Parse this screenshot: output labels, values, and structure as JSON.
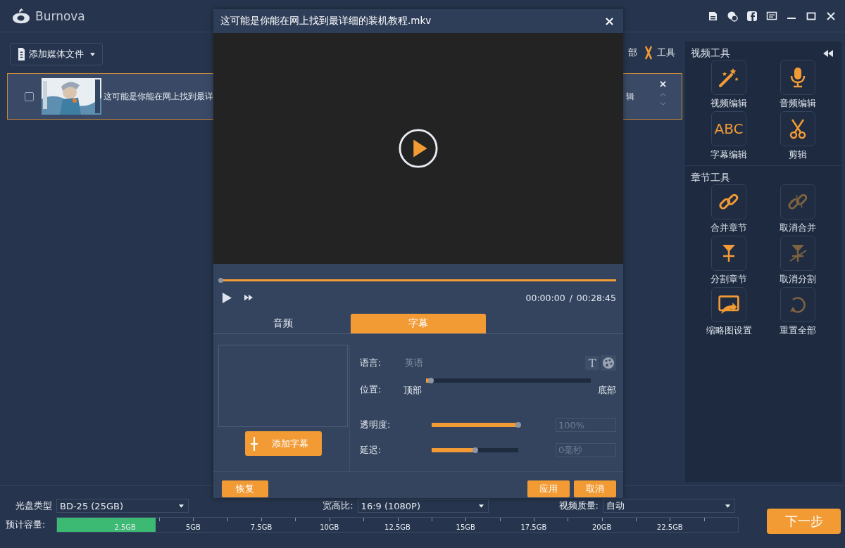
{
  "app": {
    "name": "Burnova"
  },
  "toolbar": {
    "add_media": "添加媒体文件",
    "partial_label": "部",
    "tools": "工具"
  },
  "file_row": {
    "selected": true,
    "checked": false,
    "title": "这可能是你能在网上找到最详",
    "partial_text": "辑"
  },
  "right_panel": {
    "sections": [
      {
        "title": "视频工具",
        "tools": [
          {
            "kind": "wand",
            "label": "视频编辑",
            "disabled": false
          },
          {
            "kind": "mic",
            "label": "音频编辑",
            "disabled": false
          },
          {
            "kind": "text",
            "glyph": "ABC",
            "label": "字幕编辑",
            "disabled": false
          },
          {
            "kind": "scissors",
            "label": "剪辑",
            "disabled": false
          }
        ]
      },
      {
        "title": "章节工具",
        "tools": [
          {
            "kind": "link",
            "label": "合并章节",
            "disabled": false
          },
          {
            "kind": "unlink",
            "label": "取消合并",
            "disabled": true
          },
          {
            "kind": "split",
            "label": "分割章节",
            "disabled": false
          },
          {
            "kind": "unsplit",
            "label": "取消分割",
            "disabled": true
          },
          {
            "kind": "thumbnail",
            "label": "缩略图设置",
            "disabled": false
          },
          {
            "kind": "reset",
            "label": "重置全部",
            "disabled": true
          }
        ]
      }
    ]
  },
  "dialog": {
    "title": "这可能是你能在网上找到最详细的装机教程.mkv",
    "progress": {
      "level": 0
    },
    "time_current": "00:00:00",
    "time_separator": "/",
    "time_total": "00:28:45",
    "tabs": [
      {
        "label": "音频",
        "selected": false
      },
      {
        "label": "字幕",
        "selected": true
      }
    ],
    "add_subtitle": "添加字幕",
    "language": {
      "label": "语言:",
      "value": "英语",
      "font_icon": "T"
    },
    "position": {
      "label": "位置:",
      "level": 0.03,
      "min_label": "顶部",
      "max_label": "底部"
    },
    "opacity": {
      "label": "透明度:",
      "level": 1,
      "value": "100%"
    },
    "delay": {
      "label": "延迟:",
      "level": 0.5,
      "value": "0毫秒"
    },
    "buttons": {
      "reset": "恢复",
      "apply": "应用",
      "cancel": "取消"
    }
  },
  "bottom": {
    "disc_type": {
      "label": "光盘类型",
      "value": "BD-25 (25GB)"
    },
    "aspect": {
      "label": "宽高比:",
      "value": "16:9 (1080P)"
    },
    "quality": {
      "label": "视频质量:",
      "value": "自动"
    },
    "capacity": {
      "label": "预计容量:",
      "level": 0.145,
      "ticks": [
        "2.5GB",
        "5GB",
        "7.5GB",
        "10GB",
        "12.5GB",
        "15GB",
        "17.5GB",
        "20GB",
        "22.5GB"
      ]
    },
    "next": "下一步"
  }
}
